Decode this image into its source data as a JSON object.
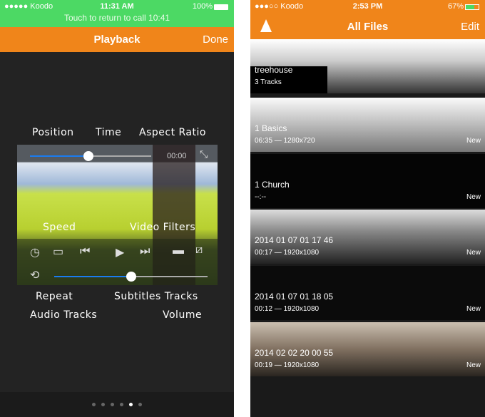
{
  "left": {
    "status": {
      "carrier": "●●●●● Koodo",
      "time": "11:31 AM",
      "battery": "100%",
      "call_banner": "Touch to return to call  10:41"
    },
    "nav": {
      "title": "Playback",
      "done": "Done"
    },
    "player": {
      "time": "00:00",
      "position_fraction": 0.48,
      "volume_fraction": 0.5
    },
    "annotations": {
      "position": "Position",
      "time": "Time",
      "aspect_ratio": "Aspect Ratio",
      "speed": "Speed",
      "video_filters": "Video Filters",
      "repeat": "Repeat",
      "subtitles_tracks": "Subtitles Tracks",
      "audio_tracks": "Audio Tracks",
      "volume": "Volume"
    },
    "page_dots": {
      "count": 6,
      "active": 4
    }
  },
  "right": {
    "status": {
      "carrier": "●●●○○ Koodo",
      "time": "2:53 PM",
      "battery": "67%"
    },
    "nav": {
      "title": "All Files",
      "edit": "Edit"
    },
    "files": [
      {
        "name": "treehouse",
        "meta": "3 Tracks",
        "badge": ""
      },
      {
        "name": "1 Basics",
        "meta": "06:35 — 1280x720",
        "badge": "New"
      },
      {
        "name": "1 Church",
        "meta": "--:--",
        "badge": "New"
      },
      {
        "name": "2014 01 07 01 17 46",
        "meta": "00:17 — 1920x1080",
        "badge": "New"
      },
      {
        "name": "2014 01 07 01 18 05",
        "meta": "00:12 — 1920x1080",
        "badge": "New"
      },
      {
        "name": "2014 02 02 20 00 55",
        "meta": "00:19 — 1920x1080",
        "badge": "New"
      }
    ]
  }
}
